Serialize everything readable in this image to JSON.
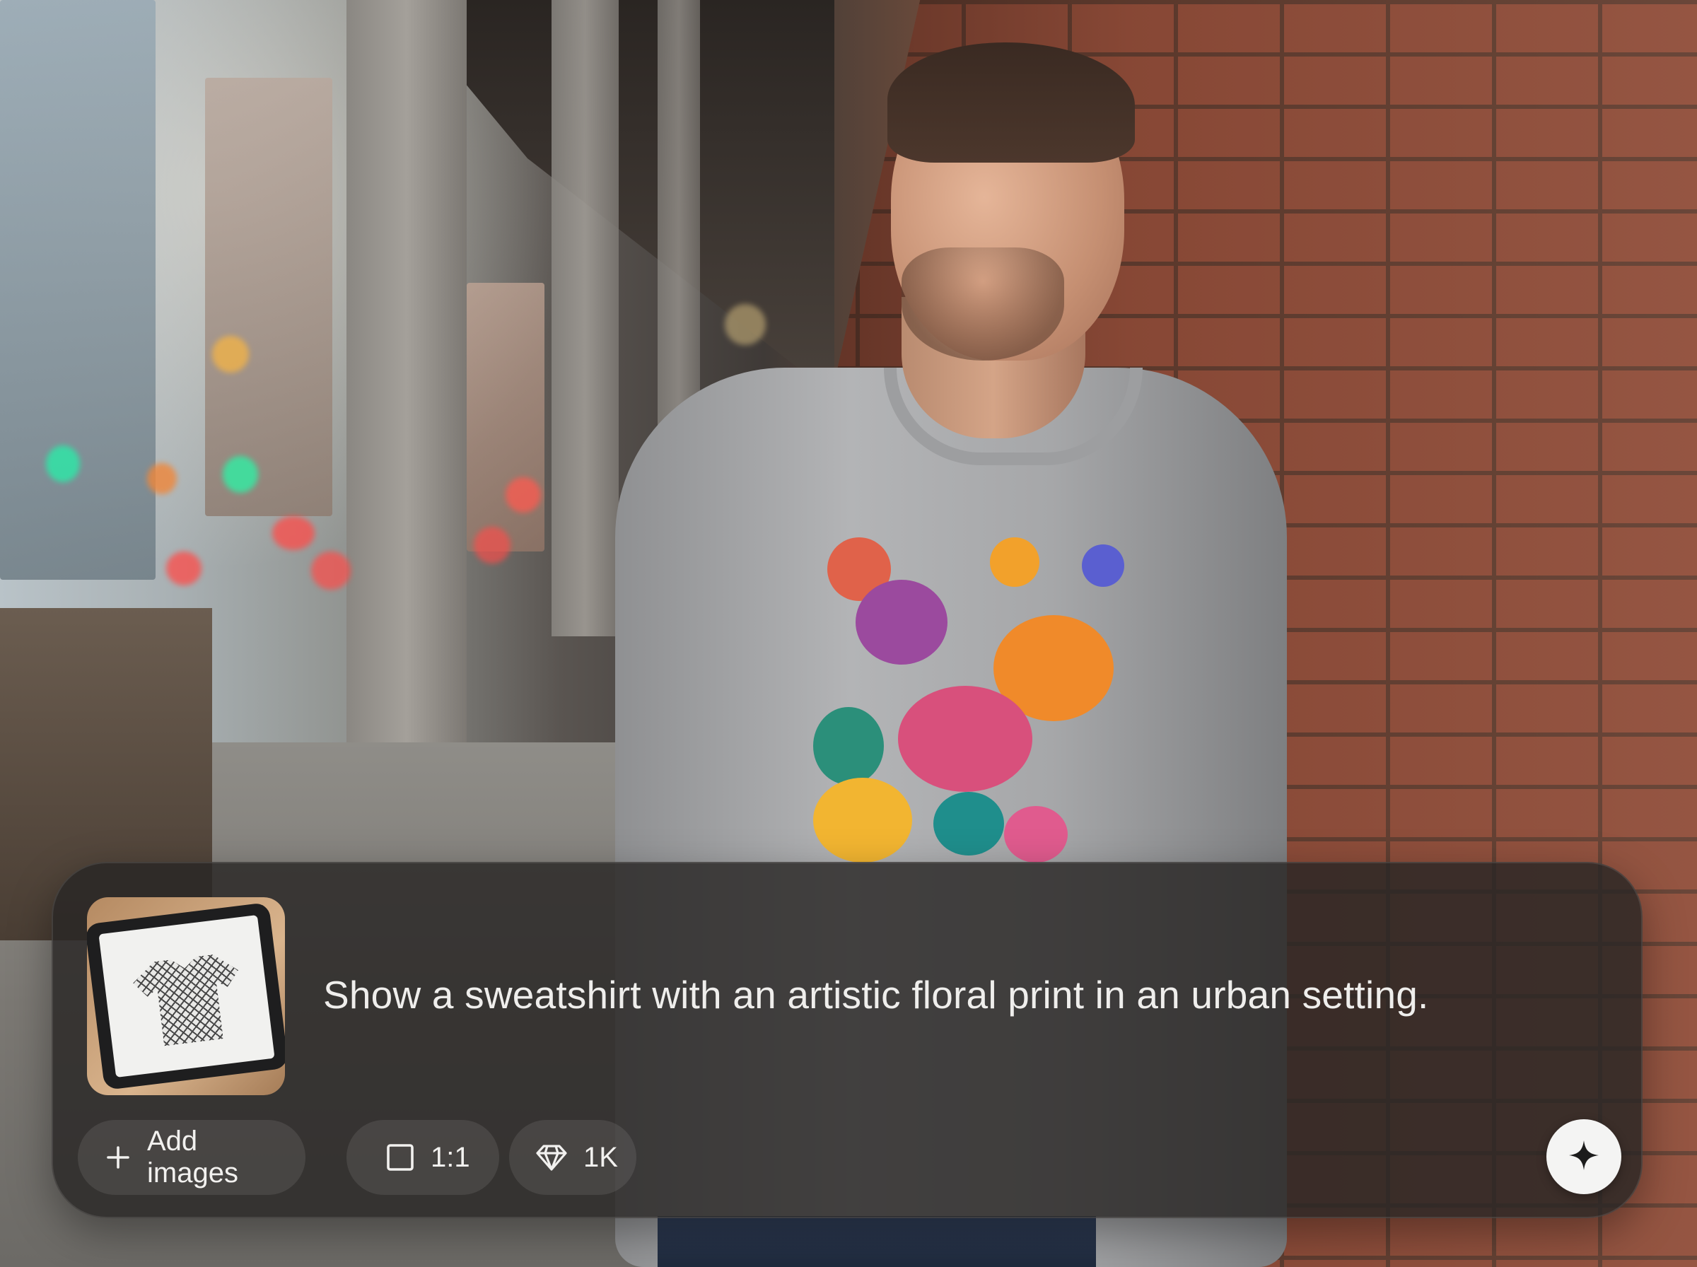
{
  "scene": {
    "description_icon": "photo-background"
  },
  "prompt_panel": {
    "reference_image_icon": "tablet-sketch-thumbnail",
    "prompt_text": "Show a sweatshirt with an artistic floral print in an urban setting.",
    "add_images_label": "Add images",
    "add_icon": "plus-icon",
    "aspect_ratio_icon": "square-icon",
    "aspect_ratio_label": "1:1",
    "resolution_icon": "diamond-icon",
    "resolution_label": "1K",
    "generate_icon": "sparkle-icon"
  },
  "colors": {
    "panel_background": "#282625",
    "chip_background": "#3a3837",
    "text": "#efeeec",
    "generate_button": "#f4f4f3",
    "generate_icon": "#1c1c1c"
  }
}
